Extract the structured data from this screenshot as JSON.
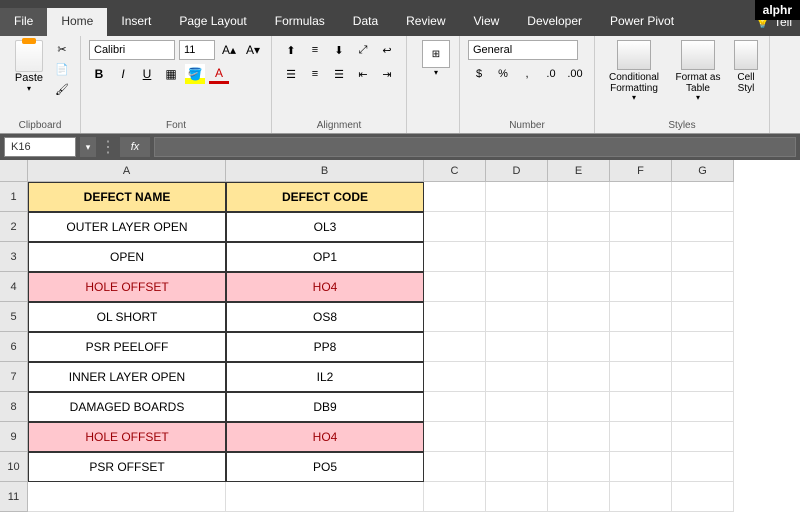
{
  "logo": "alphr",
  "tabs": {
    "file": "File",
    "home": "Home",
    "insert": "Insert",
    "page_layout": "Page Layout",
    "formulas": "Formulas",
    "data": "Data",
    "review": "Review",
    "view": "View",
    "developer": "Developer",
    "power_pivot": "Power Pivot",
    "tell": "Tell"
  },
  "ribbon": {
    "clipboard": {
      "label": "Clipboard",
      "paste": "Paste"
    },
    "font": {
      "label": "Font",
      "name": "Calibri",
      "size": "11",
      "bold": "B",
      "italic": "I",
      "underline": "U"
    },
    "alignment": {
      "label": "Alignment"
    },
    "number": {
      "label": "Number",
      "format": "General"
    },
    "styles": {
      "label": "Styles",
      "conditional": "Conditional Formatting",
      "table": "Format as Table",
      "cell": "Cell Styl"
    }
  },
  "namebox": "K16",
  "fx_label": "fx",
  "columns": [
    "A",
    "B",
    "C",
    "D",
    "E",
    "F",
    "G"
  ],
  "rows": [
    "1",
    "2",
    "3",
    "4",
    "5",
    "6",
    "7",
    "8",
    "9",
    "10",
    "11"
  ],
  "table": {
    "headers": {
      "name": "DEFECT NAME",
      "code": "DEFECT CODE"
    },
    "data": [
      {
        "name": "OUTER LAYER OPEN",
        "code": "OL3",
        "hl": false
      },
      {
        "name": "OPEN",
        "code": "OP1",
        "hl": false
      },
      {
        "name": "HOLE OFFSET",
        "code": "HO4",
        "hl": true
      },
      {
        "name": "OL SHORT",
        "code": "OS8",
        "hl": false
      },
      {
        "name": "PSR PEELOFF",
        "code": "PP8",
        "hl": false
      },
      {
        "name": "INNER LAYER OPEN",
        "code": "IL2",
        "hl": false
      },
      {
        "name": "DAMAGED BOARDS",
        "code": "DB9",
        "hl": false
      },
      {
        "name": "HOLE OFFSET",
        "code": "HO4",
        "hl": true
      },
      {
        "name": "PSR OFFSET",
        "code": "PO5",
        "hl": false
      }
    ]
  }
}
